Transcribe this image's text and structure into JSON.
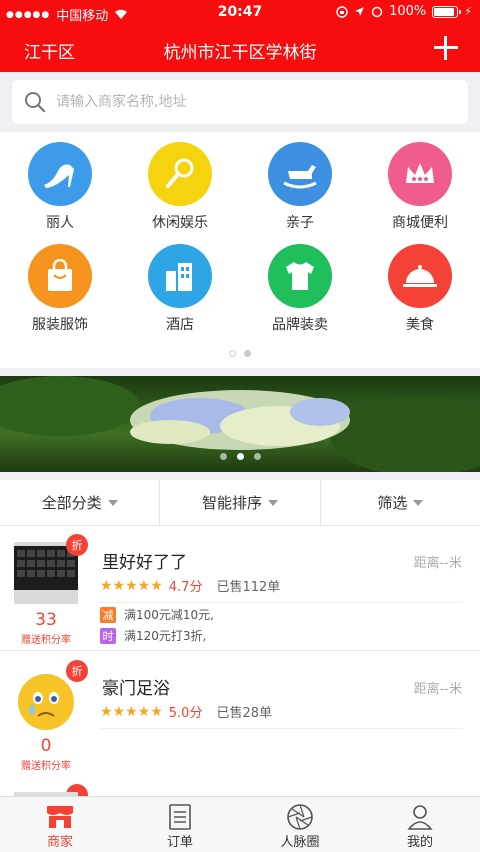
{
  "status_bar": {
    "carrier": "中国移动",
    "time": "20:47",
    "battery": "100%"
  },
  "navbar": {
    "district": "江干区",
    "title": "杭州市江干区学林街"
  },
  "search": {
    "placeholder": "请输入商家名称,地址"
  },
  "categories": [
    {
      "label": "丽人",
      "color": "#3d9be9",
      "icon": "high-heel-icon"
    },
    {
      "label": "休闲娱乐",
      "color": "#f5d30f",
      "icon": "microphone-icon"
    },
    {
      "label": "亲子",
      "color": "#3d8fe0",
      "icon": "rocking-horse-icon"
    },
    {
      "label": "商城便利",
      "color": "#f05c8e",
      "icon": "crown-icon"
    },
    {
      "label": "服装服饰",
      "color": "#f5931e",
      "icon": "shopping-bag-icon"
    },
    {
      "label": "酒店",
      "color": "#2ea6e6",
      "icon": "hotel-building-icon"
    },
    {
      "label": "品牌装卖",
      "color": "#1fbf5c",
      "icon": "tshirt-icon"
    },
    {
      "label": "美食",
      "color": "#f44336",
      "icon": "food-cloche-icon"
    }
  ],
  "filters": {
    "category": "全部分类",
    "sort": "智能排序",
    "filter": "筛选"
  },
  "shops": [
    {
      "name": "里好好了了",
      "distance": "距离--米",
      "score": "4.7分",
      "stars": "★★★★★",
      "sold": "已售112单",
      "discount": "折",
      "points": "33",
      "points_label": "赠送积分率",
      "promos": [
        {
          "tag": "减",
          "color": "#ff7b2c",
          "text": "满100元减10元,"
        },
        {
          "tag": "时",
          "color": "#b866e6",
          "text": "满120元打3折,"
        }
      ]
    },
    {
      "name": "豪门足浴",
      "distance": "距离--米",
      "score": "5.0分",
      "stars": "★★★★★",
      "sold": "已售28单",
      "discount": "折",
      "points": "0",
      "points_label": "赠送积分率",
      "promos": []
    }
  ],
  "tabs": [
    {
      "label": "商家",
      "icon": "shop-icon",
      "active": true
    },
    {
      "label": "订单",
      "icon": "order-list-icon",
      "active": false
    },
    {
      "label": "人脉圈",
      "icon": "aperture-icon",
      "active": false
    },
    {
      "label": "我的",
      "icon": "user-icon",
      "active": false
    }
  ],
  "colors": {
    "brand_red": "#f70d0d",
    "accent_red": "#f44336",
    "star_gold": "#f5a623"
  }
}
